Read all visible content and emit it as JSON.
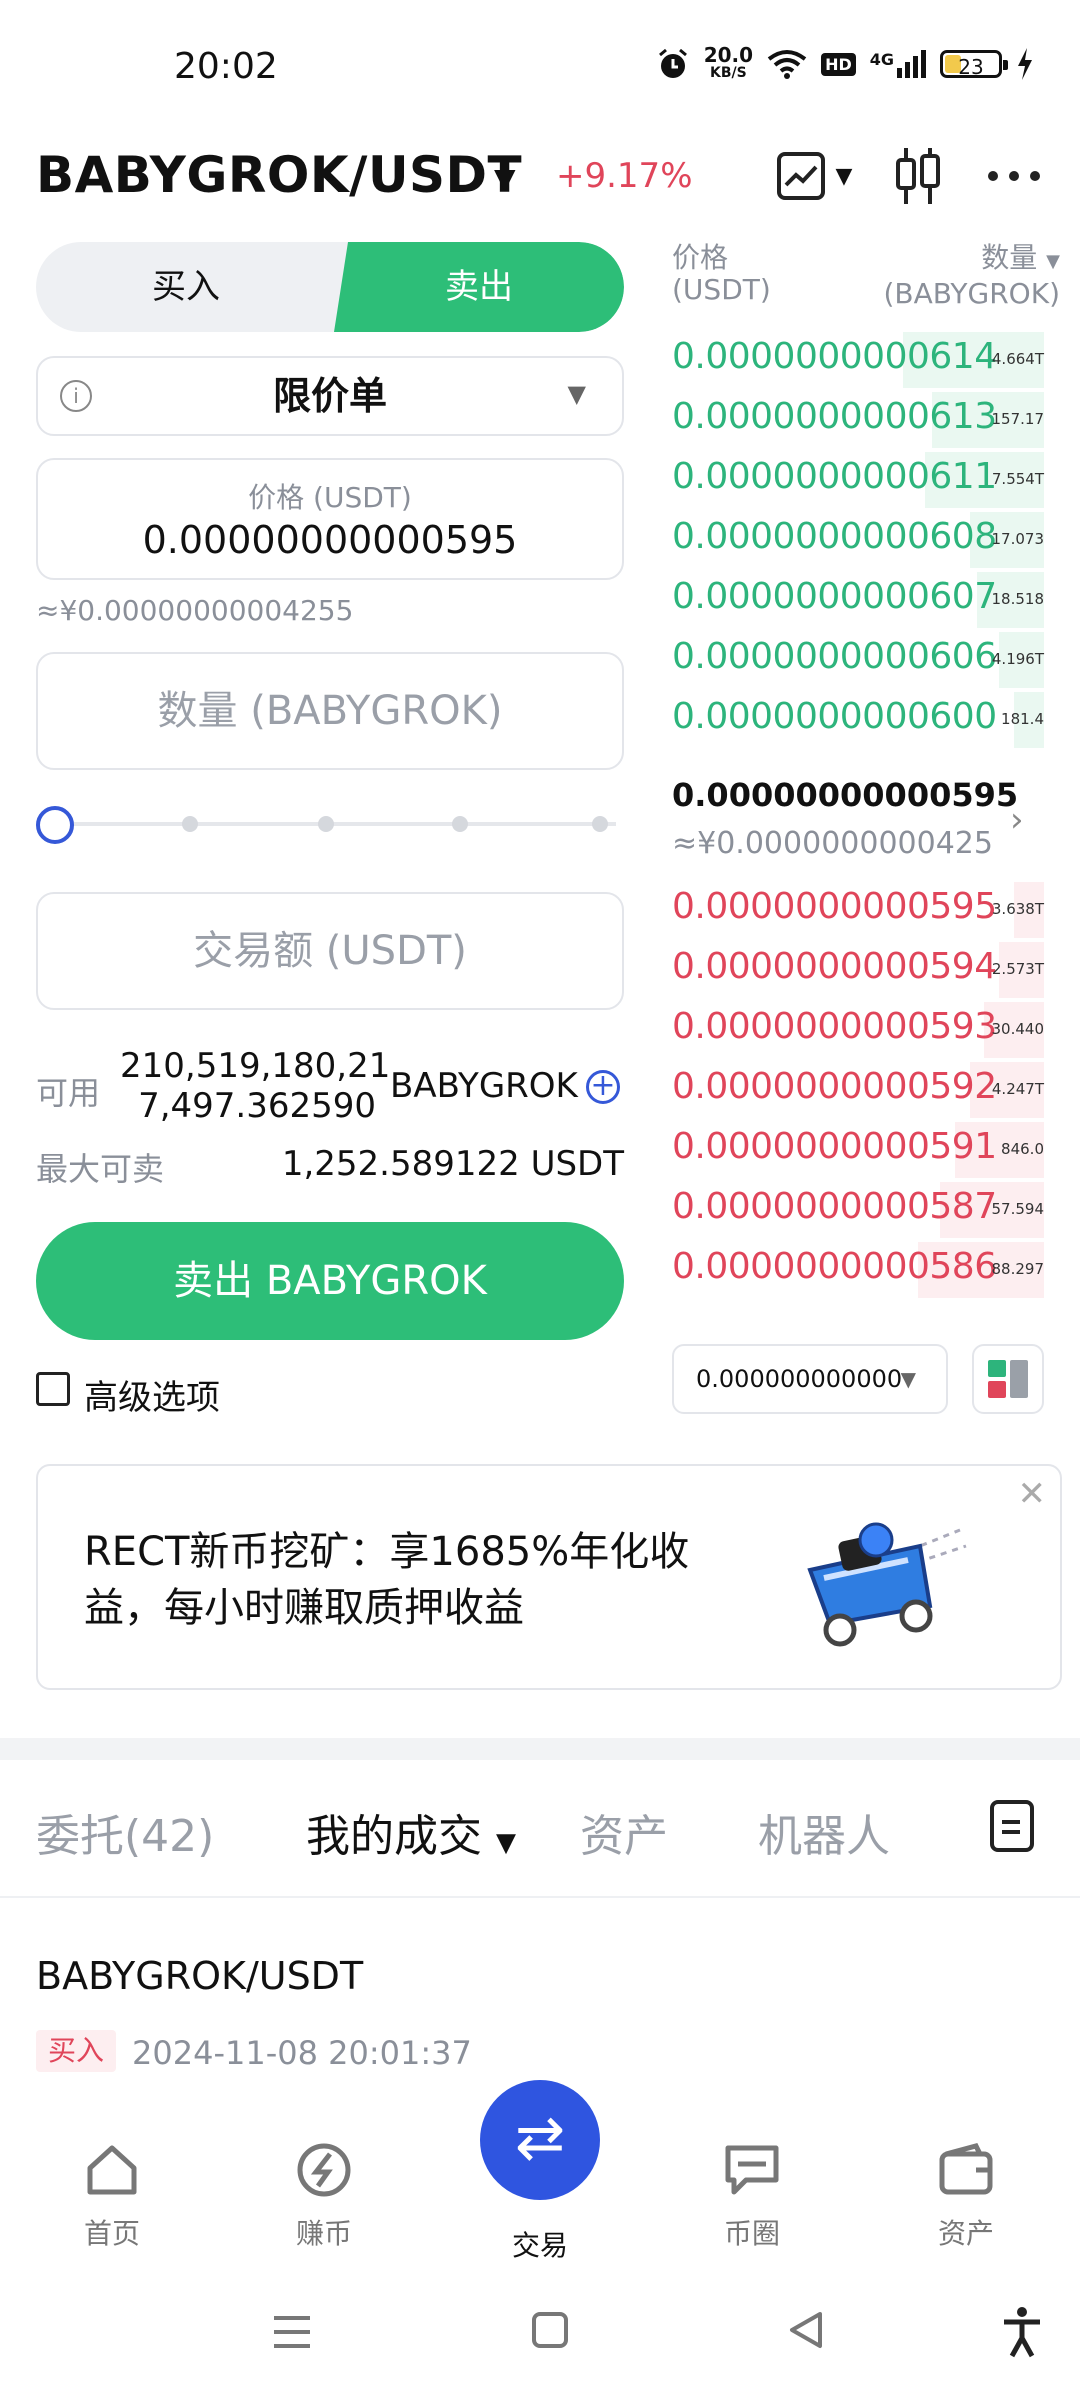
{
  "status_bar": {
    "time": "20:02",
    "speed": "20.0",
    "speed_unit": "KB/S",
    "hd": "HD",
    "network": "4G",
    "battery": "23"
  },
  "header": {
    "pair": "BABYGROK/USDT",
    "change": "+9.17%",
    "icons": [
      "chart-icon",
      "candlestick-icon",
      "more-icon"
    ]
  },
  "trade_form": {
    "buy_label": "买入",
    "sell_label": "卖出",
    "order_type": "限价单",
    "price_placeholder": "价格 (USDT)",
    "price_value": "0.00000000000595",
    "price_approx": "≈¥0.00000000004255",
    "qty_placeholder": "数量 (BABYGROK)",
    "amount_placeholder": "交易额 (USDT)",
    "slider_percent": 0,
    "available_label": "可用",
    "available_value": "210,519,180,217,497.362590",
    "available_value_line1": "210,519,180,21",
    "available_value_line2": "7,497.362590",
    "available_unit": "BABYGROK",
    "max_sell_label": "最大可卖",
    "max_sell_value": "1,252.589122 USDT",
    "submit_label": "卖出 BABYGROK",
    "advanced_label": "高级选项"
  },
  "orderbook": {
    "price_header": "价格",
    "price_header_unit": "(USDT)",
    "qty_header": "数量",
    "qty_header_unit": "(BABYGROK)",
    "bids": [
      {
        "price": "0.0000000000614",
        "qty": "4.664T"
      },
      {
        "price": "0.0000000000613",
        "qty": "157.17"
      },
      {
        "price": "0.0000000000611",
        "qty": "7.554T"
      },
      {
        "price": "0.0000000000608",
        "qty": "17.073"
      },
      {
        "price": "0.0000000000607",
        "qty": "18.518"
      },
      {
        "price": "0.0000000000606",
        "qty": "4.196T"
      },
      {
        "price": "0.0000000000600",
        "qty": "181.4"
      }
    ],
    "mid_price": "0.00000000000595",
    "mid_approx": "≈¥0.0000000000425",
    "asks": [
      {
        "price": "0.0000000000595",
        "qty": "3.638T"
      },
      {
        "price": "0.0000000000594",
        "qty": "2.573T"
      },
      {
        "price": "0.0000000000593",
        "qty": "30.440"
      },
      {
        "price": "0.0000000000592",
        "qty": "4.247T"
      },
      {
        "price": "0.0000000000591",
        "qty": "846.0"
      },
      {
        "price": "0.0000000000587",
        "qty": "57.594"
      },
      {
        "price": "0.0000000000586",
        "qty": "88.297"
      }
    ],
    "precision": "0.000000000000"
  },
  "banner": {
    "text": "RECT新币挖矿：享1685%年化收益，每小时赚取质押收益"
  },
  "tabs": [
    {
      "label": "委托(42)"
    },
    {
      "label": "我的成交"
    },
    {
      "label": "资产"
    },
    {
      "label": "机器人"
    }
  ],
  "trade_record": {
    "pair": "BABYGROK/USDT",
    "side": "买入",
    "time": "2024-11-08 20:01:37"
  },
  "bottom_nav": [
    {
      "label": "首页",
      "icon": "home-icon"
    },
    {
      "label": "赚币",
      "icon": "earn-icon"
    },
    {
      "label": "交易",
      "icon": "trade-swap-icon"
    },
    {
      "label": "币圈",
      "icon": "chat-icon"
    },
    {
      "label": "资产",
      "icon": "wallet-icon"
    }
  ],
  "colors": {
    "green": "#2dbe78",
    "red": "#e0455a",
    "blue": "#2f55e0"
  }
}
